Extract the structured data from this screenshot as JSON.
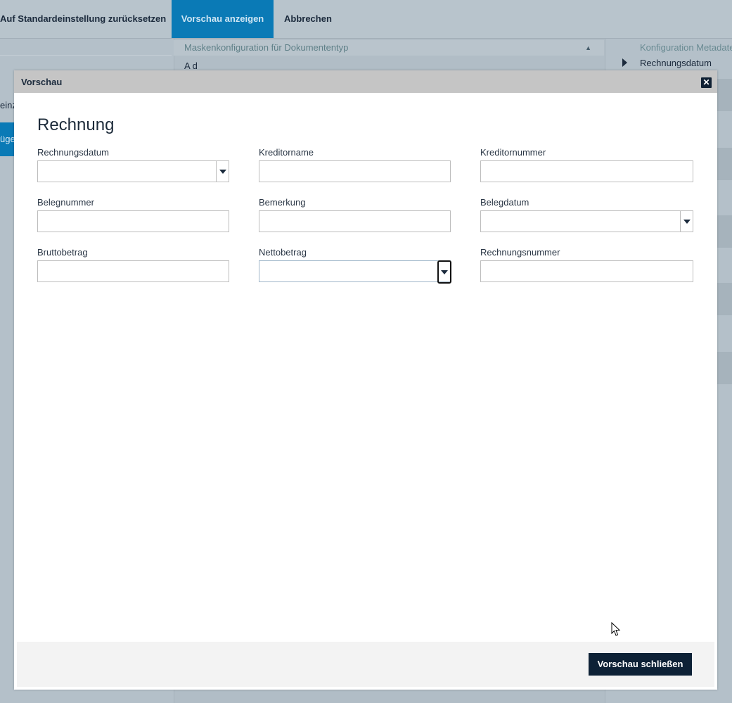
{
  "toolbar": {
    "reset_label": "Auf Standardeinstellung zurücksetzen",
    "preview_label": "Vorschau anzeigen",
    "cancel_label": "Abbrechen"
  },
  "background": {
    "left_text": "einz",
    "left_button": "üge",
    "mid_header": "Maskenkonfiguration für Dokumententyp",
    "mid_sub": "A        d",
    "right_header": "Konfiguration Metadate",
    "right_item": "Rechnungsdatum"
  },
  "colors": {
    "accent": "#0a7ab6",
    "dark_button": "#0d2136",
    "title_bar": "#c5c5c5",
    "backdrop": "#b4c0c9"
  },
  "modal": {
    "title": "Vorschau",
    "close_icon": "close-icon",
    "form_title": "Rechnung",
    "fields": [
      {
        "label": "Rechnungsdatum",
        "value": "",
        "type": "dropdown"
      },
      {
        "label": "Kreditorname",
        "value": "",
        "type": "text"
      },
      {
        "label": "Kreditornummer",
        "value": "",
        "type": "text"
      },
      {
        "label": "Belegnummer",
        "value": "",
        "type": "text"
      },
      {
        "label": "Bemerkung",
        "value": "",
        "type": "text"
      },
      {
        "label": "Belegdatum",
        "value": "",
        "type": "dropdown"
      },
      {
        "label": "Bruttobetrag",
        "value": "",
        "type": "text"
      },
      {
        "label": "Nettobetrag",
        "value": "",
        "type": "dropdown"
      },
      {
        "label": "Rechnungsnummer",
        "value": "",
        "type": "text"
      }
    ],
    "close_button_label": "Vorschau schließen"
  }
}
